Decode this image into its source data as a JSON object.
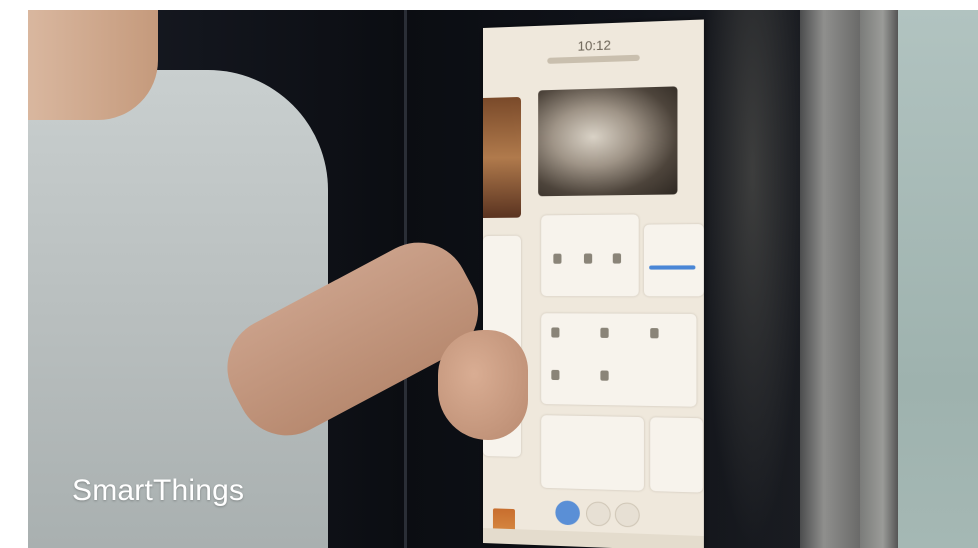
{
  "video": {
    "brand_caption": "SmartThings"
  },
  "screen": {
    "clock": "10:12",
    "dock_icons": [
      "home-icon",
      "chat-icon",
      "settings-icon"
    ]
  },
  "colors": {
    "caption_text": "#ffffff",
    "screen_background": "#efe8dc",
    "accent_blue": "#4a86d6"
  }
}
